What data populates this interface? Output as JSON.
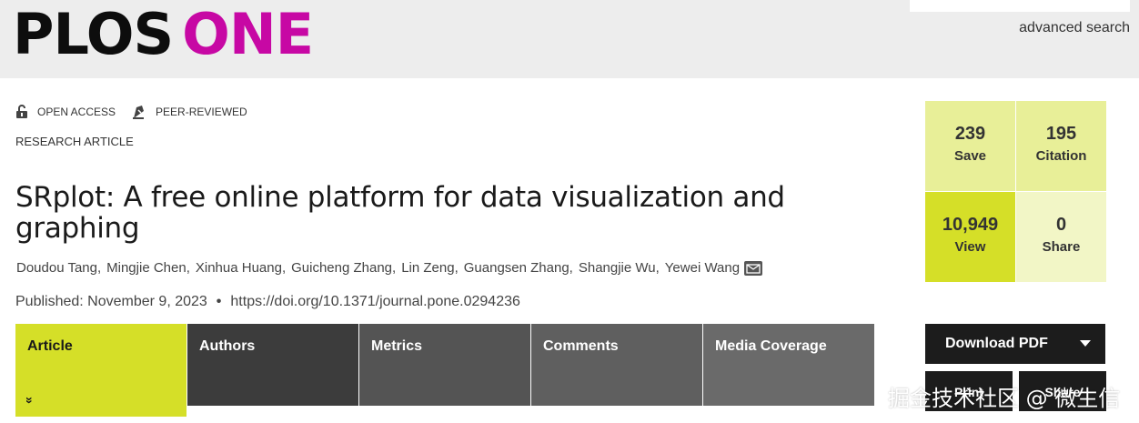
{
  "header": {
    "logo_plos": "PLOS",
    "logo_one": "ONE",
    "advanced_search": "advanced search"
  },
  "badges": {
    "open_access": "OPEN ACCESS",
    "peer_reviewed": "PEER-REVIEWED"
  },
  "article_type": "RESEARCH ARTICLE",
  "title": "SRplot: A free online platform for data visualization and graphing",
  "authors": [
    "Doudou Tang",
    "Mingjie Chen",
    "Xinhua Huang",
    "Guicheng Zhang",
    "Lin Zeng",
    "Guangsen Zhang",
    "Shangjie Wu",
    "Yewei Wang"
  ],
  "published": {
    "label": "Published: November 9, 2023",
    "separator": "•",
    "doi": "https://doi.org/10.1371/journal.pone.0294236"
  },
  "tabs": [
    {
      "label": "Article",
      "chevron": "»"
    },
    {
      "label": "Authors"
    },
    {
      "label": "Metrics"
    },
    {
      "label": "Comments"
    },
    {
      "label": "Media Coverage"
    }
  ],
  "metrics": [
    {
      "value": "239",
      "label": "Save"
    },
    {
      "value": "195",
      "label": "Citation"
    },
    {
      "value": "10,949",
      "label": "View"
    },
    {
      "value": "0",
      "label": "Share"
    }
  ],
  "buttons": {
    "download_pdf": "Download PDF",
    "print": "Print",
    "share": "Share"
  },
  "watermark": "掘金技术社区 @ 微生信",
  "colors": {
    "brand_magenta": "#c708a4",
    "accent_lime": "#d5df28",
    "metric_light": "#e8ef98",
    "metric_lighter": "#f2f6c6",
    "tab_dark": "#3c3c3c"
  }
}
